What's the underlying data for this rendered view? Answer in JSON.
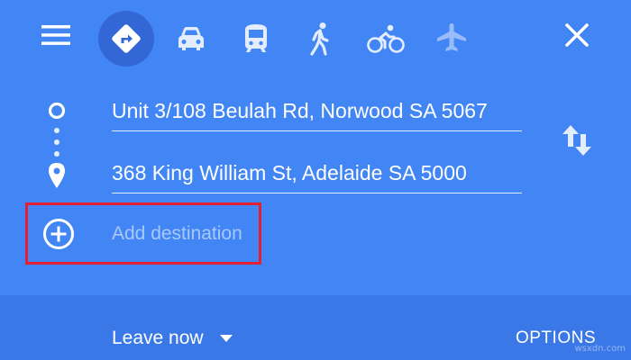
{
  "colors": {
    "panel": "#4285f4",
    "bottom_bar": "#3b78e7",
    "selected_mode": "#3367d6",
    "highlight_box": "#e2202f",
    "text": "#ffffff"
  },
  "toolbar": {
    "menu_icon": "menu-icon",
    "modes": [
      {
        "icon": "driving-directions-icon",
        "selected": true
      },
      {
        "icon": "car-icon",
        "selected": false
      },
      {
        "icon": "transit-icon",
        "selected": false
      },
      {
        "icon": "walking-icon",
        "selected": false
      },
      {
        "icon": "cycling-icon",
        "selected": false
      },
      {
        "icon": "flight-icon",
        "selected": false,
        "disabled": true
      }
    ],
    "close_icon": "close-icon"
  },
  "route": {
    "origin": "Unit 3/108 Beulah Rd, Norwood SA 5067",
    "destination": "368 King William St, Adelaide SA 5000",
    "swap_icon": "swap-icon"
  },
  "add_destination": {
    "label": "Add destination",
    "icon": "add-circle-icon"
  },
  "bottom": {
    "leave_now": "Leave now",
    "options": "OPTIONS"
  },
  "watermark": "wsxdn.com"
}
